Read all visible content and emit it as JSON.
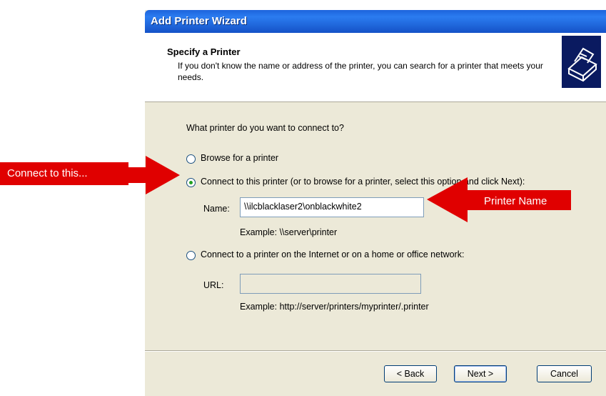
{
  "window": {
    "title": "Add Printer Wizard"
  },
  "header": {
    "title": "Specify a Printer",
    "subtitle": "If you don't know the name or address of the printer, you can search for a printer that meets your needs.",
    "icon": "printer-icon"
  },
  "content": {
    "question": "What printer do you want to connect to?",
    "option_browse": "Browse for a printer",
    "option_connect": "Connect to this printer (or to browse for a printer, select this option and click Next):",
    "name_label": "Name:",
    "name_value": "\\\\ilcblacklaser2\\onblackwhite2",
    "name_example": "Example: \\\\server\\printer",
    "option_internet": "Connect to a printer on the Internet or on a home or office network:",
    "url_label": "URL:",
    "url_value": "",
    "url_example": "Example: http://server/printers/myprinter/.printer",
    "selected_option": "connect"
  },
  "buttons": {
    "back": "< Back",
    "next": "Next >",
    "cancel": "Cancel"
  },
  "annotations": {
    "connect_label": "Connect to this...",
    "printer_name_label": "Printer Name",
    "color": "#e00000"
  }
}
